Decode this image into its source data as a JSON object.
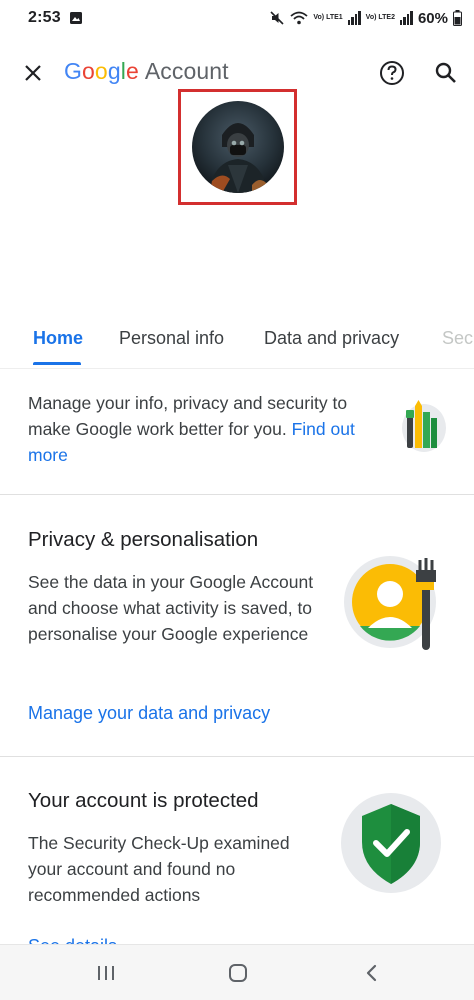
{
  "status": {
    "time": "2:53",
    "carrier1": "Vo) LTE1",
    "carrier2": "Vo) LTE2",
    "battery": "60%"
  },
  "header": {
    "close_icon": "close-icon",
    "logo_letters": [
      {
        "ch": "G",
        "color": "#4285F4"
      },
      {
        "ch": "o",
        "color": "#EA4335"
      },
      {
        "ch": "o",
        "color": "#FBBC05"
      },
      {
        "ch": "g",
        "color": "#4285F4"
      },
      {
        "ch": "l",
        "color": "#34A853"
      },
      {
        "ch": "e",
        "color": "#EA4335"
      }
    ],
    "title_suffix": "Account",
    "help_icon": "help-icon",
    "search_icon": "search-icon"
  },
  "tabs": [
    {
      "label": "Home",
      "active": true
    },
    {
      "label": "Personal info",
      "active": false
    },
    {
      "label": "Data and privacy",
      "active": false
    },
    {
      "label": "Sec",
      "active": false
    }
  ],
  "intro": {
    "text": "Manage your info, privacy and security to make Google work better for you. ",
    "link": "Find out more"
  },
  "privacy": {
    "title": "Privacy & personalisation",
    "body": "See the data in your Google Account and choose what activity is saved, to personalise your Google experience",
    "link": "Manage your data and privacy"
  },
  "security": {
    "title": "Your account is protected",
    "body": "The Security Check-Up examined your account and found no recommended actions",
    "link": "See details"
  },
  "colors": {
    "accent": "#1a73e8",
    "highlight_border": "#d32f2f",
    "shield": "#1e8e3e"
  }
}
